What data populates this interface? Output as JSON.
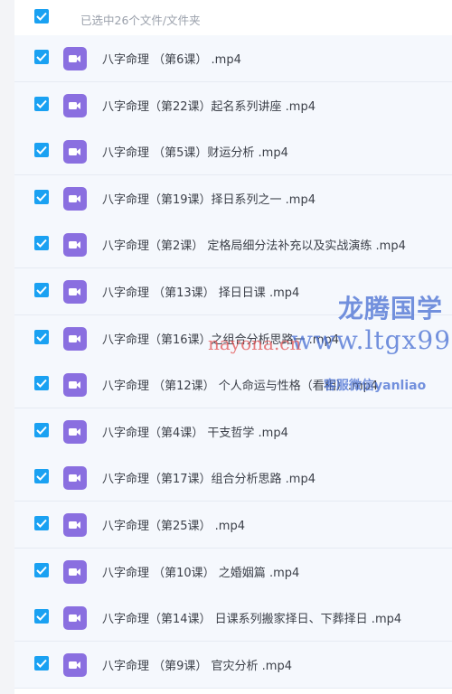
{
  "selection": {
    "summary": "已选中26个文件/文件夹",
    "all_checked": true
  },
  "files": [
    {
      "name": "八字命理 （第6课） .mp4",
      "checked": true,
      "icon": "video-file-icon"
    },
    {
      "name": "八字命理（第22课）起名系列讲座 .mp4",
      "checked": true,
      "icon": "video-file-icon"
    },
    {
      "name": "八字命理 （第5课）财运分析 .mp4",
      "checked": true,
      "icon": "video-file-icon"
    },
    {
      "name": "八字命理（第19课）择日系列之一 .mp4",
      "checked": true,
      "icon": "video-file-icon"
    },
    {
      "name": "八字命理（第2课） 定格局细分法补充以及实战演练 .mp4",
      "checked": true,
      "icon": "video-file-icon"
    },
    {
      "name": "八字命理 （第13课） 择日日课 .mp4",
      "checked": true,
      "icon": "video-file-icon"
    },
    {
      "name": "八字命理（第16课）之组合分析思路一 .mp4",
      "checked": true,
      "icon": "video-file-icon"
    },
    {
      "name": "八字命理 （第12课） 个人命运与性格（看相）.mp4",
      "checked": true,
      "icon": "video-file-icon"
    },
    {
      "name": "八字命理（第4课） 干支哲学 .mp4",
      "checked": true,
      "icon": "video-file-icon"
    },
    {
      "name": "八字命理（第17课）组合分析思路 .mp4",
      "checked": true,
      "icon": "video-file-icon"
    },
    {
      "name": "八字命理（第25课） .mp4",
      "checked": true,
      "icon": "video-file-icon"
    },
    {
      "name": "八字命理 （第10课） 之婚姻篇 .mp4",
      "checked": true,
      "icon": "video-file-icon"
    },
    {
      "name": "八字命理（第14课） 日课系列搬家择日、下葬择日 .mp4",
      "checked": true,
      "icon": "video-file-icon"
    },
    {
      "name": "八字命理 （第9课） 官灾分析 .mp4",
      "checked": true,
      "icon": "video-file-icon"
    }
  ],
  "watermarks": {
    "brand": "龙腾国学",
    "site_red": "nayona.cn",
    "site_blue": "www.ltgx99",
    "wechat": "客服微信yanliao"
  },
  "colors": {
    "checkbox": "#1aa1f2",
    "video_icon": "#8a6fe0",
    "row_bg": "#f5f8fd"
  }
}
